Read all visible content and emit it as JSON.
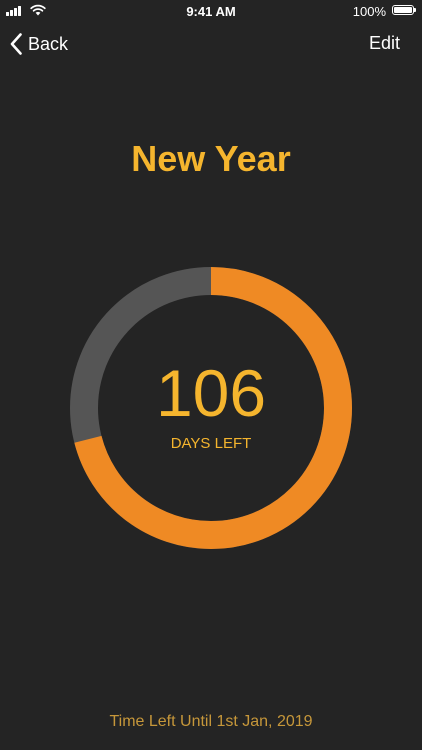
{
  "status_bar": {
    "time": "9:41 AM",
    "battery_percent": "100%",
    "battery_level": 1.0
  },
  "nav": {
    "back_label": "Back",
    "edit_label": "Edit"
  },
  "countdown": {
    "title": "New Year",
    "days_left": "106",
    "days_label": "DAYS LEFT",
    "remaining_fraction": 0.71,
    "footer": "Time Left Until 1st Jan, 2019"
  },
  "colors": {
    "background": "#242424",
    "accent": "#f5b52e",
    "ring_progress": "#ef8a24",
    "ring_track": "#555555",
    "footer_text": "#c6973a"
  },
  "icons": {
    "back": "chevron-left-icon",
    "signal": "cellular-signal-icon",
    "wifi": "wifi-icon",
    "battery": "battery-icon"
  }
}
